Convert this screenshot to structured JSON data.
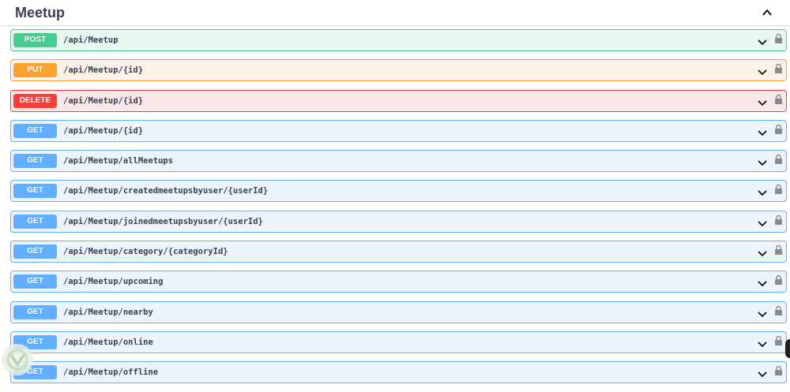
{
  "section": {
    "title": "Meetup",
    "collapse_icon": "chevron-up-icon"
  },
  "operations": [
    {
      "method": "POST",
      "path": "/api/Meetup",
      "color": "#49cc90"
    },
    {
      "method": "PUT",
      "path": "/api/Meetup/{id}",
      "color": "#fca130"
    },
    {
      "method": "DELETE",
      "path": "/api/Meetup/{id}",
      "color": "#f93e3e"
    },
    {
      "method": "GET",
      "path": "/api/Meetup/{id}",
      "color": "#61affe"
    },
    {
      "method": "GET",
      "path": "/api/Meetup/allMeetups",
      "color": "#61affe"
    },
    {
      "method": "GET",
      "path": "/api/Meetup/createdmeetupsbyuser/{userId}",
      "color": "#61affe"
    },
    {
      "method": "GET",
      "path": "/api/Meetup/joinedmeetupsbyuser/{userId}",
      "color": "#61affe"
    },
    {
      "method": "GET",
      "path": "/api/Meetup/category/{categoryId}",
      "color": "#61affe"
    },
    {
      "method": "GET",
      "path": "/api/Meetup/upcoming",
      "color": "#61affe"
    },
    {
      "method": "GET",
      "path": "/api/Meetup/nearby",
      "color": "#61affe"
    },
    {
      "method": "GET",
      "path": "/api/Meetup/online",
      "color": "#61affe"
    },
    {
      "method": "GET",
      "path": "/api/Meetup/offline",
      "color": "#61affe"
    }
  ],
  "icons": {
    "expand": "chevron-down-icon",
    "auth": "lock-icon"
  }
}
